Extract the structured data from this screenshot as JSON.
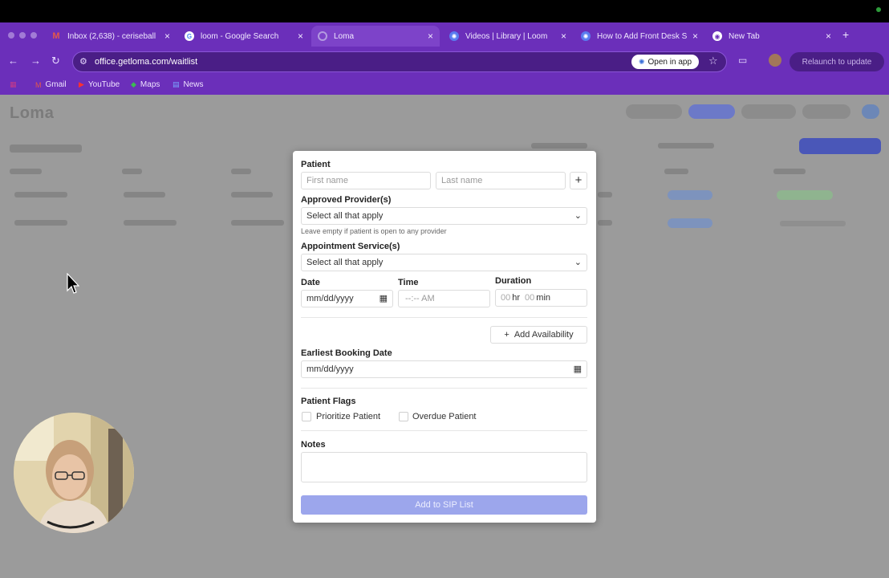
{
  "browser": {
    "tabs": [
      {
        "label": "Inbox (2,638) - ceriseball",
        "icon": "gmail-icon",
        "color": "#e2574c"
      },
      {
        "label": "loom - Google Search",
        "icon": "google-icon",
        "color": "#ffffff"
      },
      {
        "label": "Loma",
        "icon": "loma-icon",
        "color": "#b39ae0"
      },
      {
        "label": "Videos | Library | Loom",
        "icon": "loom-icon",
        "color": "#5a7cf0"
      },
      {
        "label": "How to Add Front Desk Sta",
        "icon": "loom-icon",
        "color": "#5a7cf0"
      },
      {
        "label": "New Tab",
        "icon": "chrome-icon",
        "color": "#ffffff"
      }
    ],
    "url": "office.getloma.com/waitlist",
    "open_in_app": "Open in app",
    "relaunch": "Relaunch to update",
    "bookmarks": [
      {
        "label": "Gmail",
        "icon": "gmail-icon"
      },
      {
        "label": "YouTube",
        "icon": "youtube-icon"
      },
      {
        "label": "Maps",
        "icon": "maps-icon"
      },
      {
        "label": "News",
        "icon": "news-icon"
      }
    ]
  },
  "page": {
    "logo": "Loma"
  },
  "modal": {
    "patient_label": "Patient",
    "first_name_placeholder": "First name",
    "last_name_placeholder": "Last name",
    "add_patient": "+",
    "providers_label": "Approved Provider(s)",
    "providers_placeholder": "Select all that apply",
    "providers_helper": "Leave empty if patient is open to any provider",
    "services_label": "Appointment Service(s)",
    "services_placeholder": "Select all that apply",
    "date_label": "Date",
    "date_placeholder": "mm/dd/yyyy",
    "time_label": "Time",
    "time_placeholder": "--:-- AM",
    "duration_label": "Duration",
    "duration_hr_value": "00",
    "duration_hr_unit": "hr",
    "duration_min_value": "00",
    "duration_min_unit": "min",
    "add_availability": "Add Availability",
    "earliest_label": "Earliest Booking Date",
    "earliest_placeholder": "mm/dd/yyyy",
    "flags_label": "Patient Flags",
    "flag_prioritize": "Prioritize Patient",
    "flag_overdue": "Overdue Patient",
    "notes_label": "Notes",
    "submit": "Add to SIP List"
  }
}
